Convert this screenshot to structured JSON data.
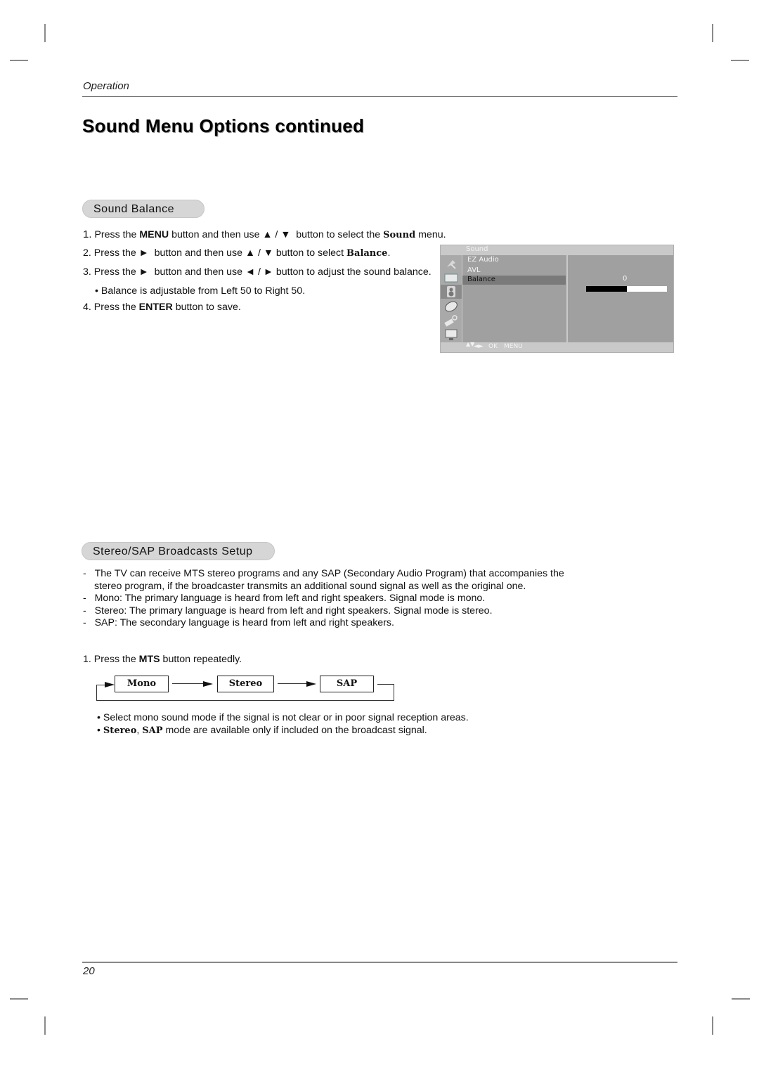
{
  "header": {
    "section": "Operation",
    "title": "Sound Menu Options continued"
  },
  "sound_balance": {
    "heading": "Sound Balance",
    "steps": [
      {
        "num": "1.",
        "parts": [
          "Press the ",
          "MENU",
          " button and then use ",
          "▲ / ▼",
          " button to select the ",
          "Sound",
          " menu."
        ]
      },
      {
        "num": "2.",
        "parts": [
          "Press the ",
          "►",
          " button and then use ",
          "▲ / ▼",
          " button to select ",
          "Balance",
          "."
        ]
      },
      {
        "num": "3.",
        "parts": [
          "Press the ",
          "►",
          " button and then use ",
          "◄ / ►",
          " button to adjust the sound balance."
        ]
      },
      {
        "num": "•",
        "parts": [
          "Balance is adjustable from Left 50 to Right 50."
        ]
      },
      {
        "num": "4.",
        "parts": [
          "Press the ",
          "ENTER",
          " button to save."
        ]
      }
    ]
  },
  "osd": {
    "title": "Sound",
    "icons": [
      "satellite-dish-icon",
      "picture-icon",
      "speaker-icon",
      "clock-icon",
      "key-lock-icon",
      "pc-monitor-icon"
    ],
    "active_icon": 2,
    "items": [
      "EZ Audio",
      "AVL",
      "Balance"
    ],
    "selected_item": "Balance",
    "balance_value": "0",
    "balance_fill_fraction": 0.5,
    "footer": {
      "updown": "▲▼",
      "leftright": "◄►",
      "ok": "OK",
      "menu": "MENU"
    }
  },
  "stereo_sap": {
    "heading": "Stereo/SAP Broadcasts Setup",
    "bullets": [
      "The TV can receive MTS stereo programs and any SAP (Secondary Audio Program) that accompanies the",
      "stereo program, if the broadcaster transmits an additional sound signal as well as the original one.",
      "Mono: The primary language is heard from left and right speakers. Signal mode is mono.",
      "Stereo: The primary language is heard from left and right speakers. Signal mode is stereo.",
      "SAP: The secondary language is heard from left and right speakers."
    ],
    "step1": {
      "pre": "1. Press the ",
      "key": "MTS",
      "post": " button repeatedly."
    },
    "flow": [
      "Mono",
      "Stereo",
      "SAP"
    ],
    "notes": [
      {
        "bold": "",
        "text": "Select mono sound mode if the signal is not clear or in poor signal reception areas."
      },
      {
        "bold1": "Stereo",
        "sep": ", ",
        "bold2": "SAP",
        "text": " mode are available only if included on the broadcast signal."
      }
    ]
  },
  "footer": {
    "page_number": "20"
  }
}
